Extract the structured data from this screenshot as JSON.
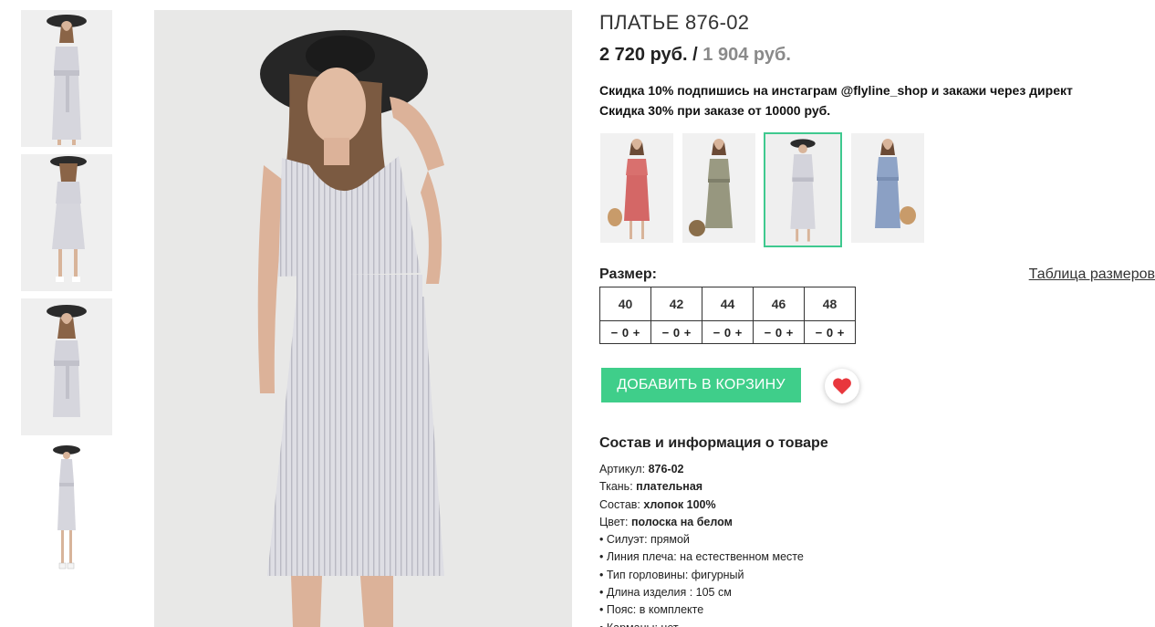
{
  "product": {
    "title": "ПЛАТЬЕ 876-02",
    "price_old": "2 720 руб.",
    "price_separator": "/",
    "price_new": "1 904 руб.",
    "promo_lines": [
      "Скидка 10% подпишись на инстаграм @flyline_shop и закажи через директ",
      "Скидка 30% при заказе от 10000 руб."
    ]
  },
  "color_variants": [
    {
      "name": "pink",
      "color": "#d9706e"
    },
    {
      "name": "olive",
      "color": "#9a9a82"
    },
    {
      "name": "grey-stripe",
      "color": "#c9c9cf",
      "selected": true
    },
    {
      "name": "blue",
      "color": "#8fa4c7"
    }
  ],
  "sizes": {
    "label": "Размер:",
    "chart_link": "Таблица размеров",
    "items": [
      {
        "size": "40",
        "minus": "−",
        "qty": "0",
        "plus": "+"
      },
      {
        "size": "42",
        "minus": "−",
        "qty": "0",
        "plus": "+"
      },
      {
        "size": "44",
        "minus": "−",
        "qty": "0",
        "plus": "+"
      },
      {
        "size": "46",
        "minus": "−",
        "qty": "0",
        "plus": "+"
      },
      {
        "size": "48",
        "minus": "−",
        "qty": "0",
        "plus": "+"
      }
    ]
  },
  "actions": {
    "add_to_cart": "ДОБАВИТЬ В КОРЗИНУ",
    "favorite_icon": "heart-icon",
    "accent_color": "#3fce8a",
    "heart_color": "#e8373d"
  },
  "details": {
    "title": "Состав и информация о товаре",
    "fields": [
      {
        "label": "Артикул:",
        "value": "876-02"
      },
      {
        "label": "Ткань:",
        "value": "плательная"
      },
      {
        "label": "Состав:",
        "value": "хлопок 100%"
      },
      {
        "label": "Цвет:",
        "value": "полоска на белом"
      }
    ],
    "bullets": [
      "• Силуэт: прямой",
      "• Линия плеча: на естественном месте",
      "• Тип горловины: фигурный",
      "• Длина изделия : 105 см",
      "• Пояс: в комплекте",
      "• Карманы: нет"
    ]
  }
}
